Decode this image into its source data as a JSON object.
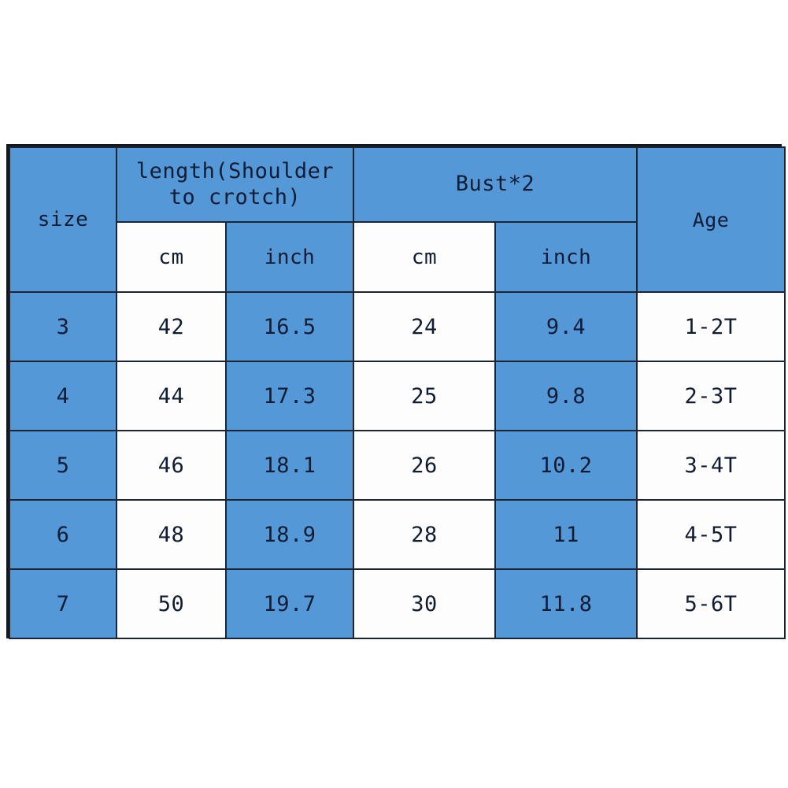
{
  "table": {
    "header": {
      "size_label": "size",
      "length_label": "length(Shoulder to crotch)",
      "bust_label": "Bust*2",
      "age_label": "Age",
      "unit_cm": "cm",
      "unit_inch": "inch"
    },
    "columns": [
      "size",
      "length cm",
      "length inch",
      "bust cm",
      "bust inch",
      "Age"
    ],
    "rows": [
      {
        "size": "3",
        "length_cm": "42",
        "length_inch": "16.5",
        "bust_cm": "24",
        "bust_inch": "9.4",
        "age": "1-2T"
      },
      {
        "size": "4",
        "length_cm": "44",
        "length_inch": "17.3",
        "bust_cm": "25",
        "bust_inch": "9.8",
        "age": "2-3T"
      },
      {
        "size": "5",
        "length_cm": "46",
        "length_inch": "18.1",
        "bust_cm": "26",
        "bust_inch": "10.2",
        "age": "3-4T"
      },
      {
        "size": "6",
        "length_cm": "48",
        "length_inch": "18.9",
        "bust_cm": "28",
        "bust_inch": "11",
        "age": "4-5T"
      },
      {
        "size": "7",
        "length_cm": "50",
        "length_inch": "19.7",
        "bust_cm": "30",
        "bust_inch": "11.8",
        "age": "5-6T"
      }
    ]
  },
  "colors": {
    "accent_blue": "#5598d8",
    "cell_white": "#fdfdfd",
    "grid_line": "#1d2433",
    "outer_border": "#11161f",
    "text": "#101c33",
    "background": "#ffffff"
  }
}
